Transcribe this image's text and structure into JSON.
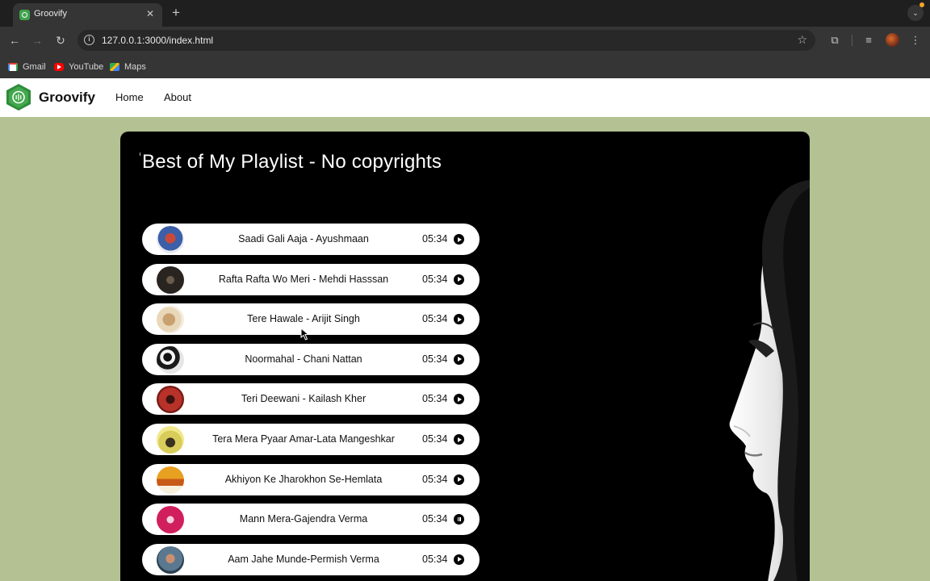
{
  "browser": {
    "tab_title": "Groovify",
    "url": "127.0.0.1:3000/index.html",
    "bookmarks": [
      {
        "label": "Gmail",
        "icon": "gmail-icon"
      },
      {
        "label": "YouTube",
        "icon": "youtube-icon"
      },
      {
        "label": "Maps",
        "icon": "maps-icon"
      }
    ]
  },
  "site": {
    "brand": "Groovify",
    "nav": [
      "Home",
      "About"
    ],
    "brand_color": "#3fa34d",
    "background_color": "#b3c193"
  },
  "playlist": {
    "title": "Best of My Playlist - No copyrights",
    "songs": [
      {
        "title": "Saadi Gali Aaja - Ayushmaan",
        "duration": "05:34",
        "state": "play"
      },
      {
        "title": "Rafta Rafta Wo Meri - Mehdi Hasssan",
        "duration": "05:34",
        "state": "play"
      },
      {
        "title": "Tere Hawale - Arijit Singh",
        "duration": "05:34",
        "state": "play"
      },
      {
        "title": "Noormahal - Chani Nattan",
        "duration": "05:34",
        "state": "play"
      },
      {
        "title": "Teri Deewani - Kailash Kher",
        "duration": "05:34",
        "state": "play"
      },
      {
        "title": "Tera Mera Pyaar Amar-Lata Mangeshkar",
        "duration": "05:34",
        "state": "play"
      },
      {
        "title": "Akhiyon Ke Jharokhon Se-Hemlata",
        "duration": "05:34",
        "state": "play"
      },
      {
        "title": "Mann Mera-Gajendra Verma",
        "duration": "05:34",
        "state": "pause"
      },
      {
        "title": "Aam Jahe Munde-Permish Verma",
        "duration": "05:34",
        "state": "play"
      }
    ]
  }
}
